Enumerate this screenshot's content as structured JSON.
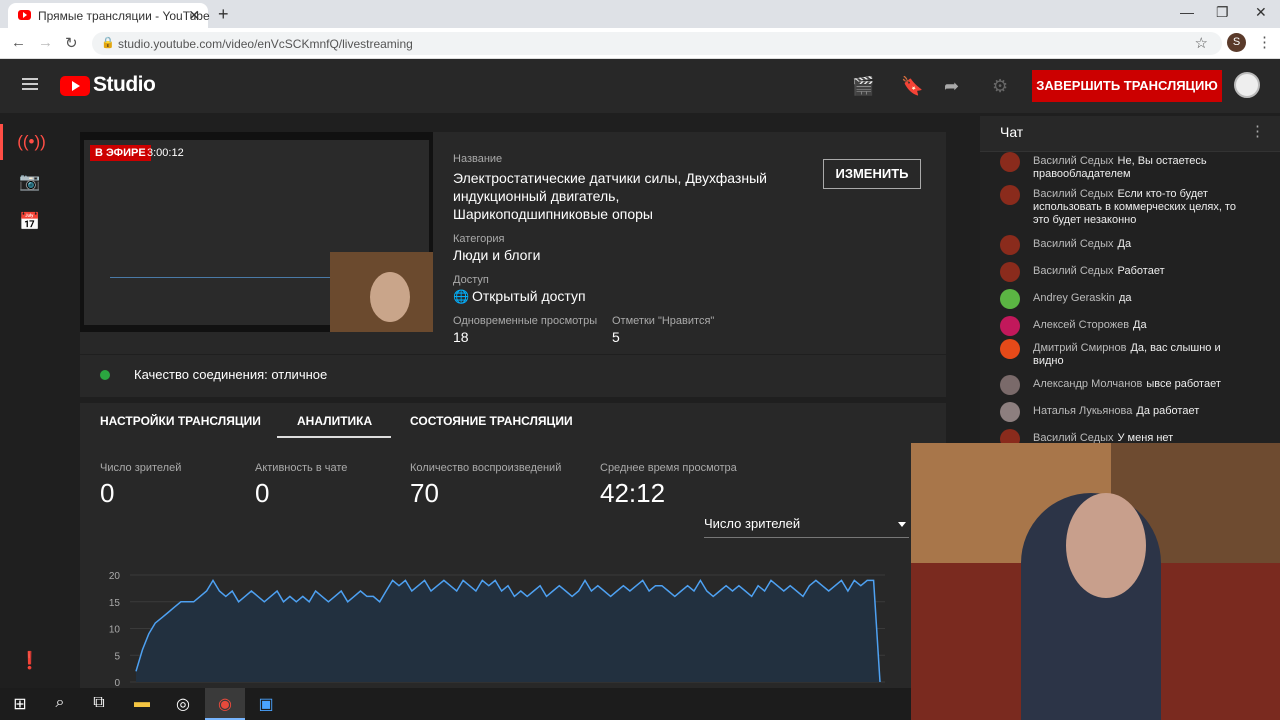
{
  "browser": {
    "tab_title": "Прямые трансляции - YouTube",
    "url": "studio.youtube.com/video/enVcSCKmnfQ/livestreaming",
    "profile_initial": "S"
  },
  "header": {
    "logo_text": "Studio",
    "end_stream_label": "ЗАВЕРШИТЬ ТРАНСЛЯЦИЮ"
  },
  "preview": {
    "live_badge": "В ЭФИРЕ",
    "live_time": "3:00:12"
  },
  "details": {
    "title_label": "Название",
    "title_value": "Электростатические датчики силы, Двухфазный индукционный двигатель, Шарикоподшипниковые опоры",
    "edit_label": "ИЗМЕНИТЬ",
    "category_label": "Категория",
    "category_value": "Люди и блоги",
    "access_label": "Доступ",
    "access_value": "Открытый доступ",
    "concurrent_label": "Одновременные просмотры",
    "concurrent_value": "18",
    "likes_label": "Отметки \"Нравится\"",
    "likes_value": "5"
  },
  "connection": {
    "text": "Качество соединения: отличное",
    "status_color": "#2ba640"
  },
  "tabs": [
    {
      "label": "НАСТРОЙКИ ТРАНСЛЯЦИИ"
    },
    {
      "label": "АНАЛИТИКА",
      "active": true
    },
    {
      "label": "СОСТОЯНИЕ ТРАНСЛЯЦИИ"
    }
  ],
  "metrics": [
    {
      "label": "Число зрителей",
      "value": "0"
    },
    {
      "label": "Активность в чате",
      "value": "0"
    },
    {
      "label": "Количество воспроизведений",
      "value": "70"
    },
    {
      "label": "Среднее время просмотра",
      "value": "42:12"
    }
  ],
  "dropdown": {
    "selected": "Число зрителей"
  },
  "chart_data": {
    "type": "area",
    "yticks": [
      "20",
      "15",
      "10",
      "5",
      "0"
    ],
    "ylim": [
      0,
      20
    ],
    "series": [
      {
        "values": [
          2,
          6,
          9,
          11,
          12,
          13,
          14,
          15,
          15,
          15,
          16,
          17,
          19,
          17,
          16,
          17,
          15,
          16,
          17,
          16,
          15,
          16,
          17,
          15,
          16,
          15,
          16,
          15,
          17,
          16,
          15,
          16,
          17,
          15,
          16,
          17,
          16,
          16,
          15,
          17,
          19,
          18,
          19,
          17,
          18,
          19,
          17,
          18,
          19,
          18,
          17,
          19,
          18,
          17,
          19,
          18,
          19,
          17,
          18,
          16,
          17,
          16,
          17,
          18,
          16,
          17,
          18,
          17,
          16,
          17,
          19,
          17,
          18,
          17,
          16,
          17,
          18,
          17,
          18,
          19,
          17,
          18,
          18,
          17,
          16,
          17,
          18,
          17,
          19,
          17,
          16,
          17,
          18,
          17,
          18,
          17,
          16,
          18,
          17,
          19,
          18,
          17,
          18,
          17,
          16,
          18,
          19,
          18,
          17,
          18,
          19,
          17,
          19,
          18,
          19,
          19,
          0
        ]
      }
    ]
  },
  "chat": {
    "title": "Чат",
    "messages": [
      {
        "author": "Василий Седых",
        "text": "Не, Вы остаетесь правообладателем",
        "color": "#8a2b1c"
      },
      {
        "author": "Василий Седых",
        "text": "Если кто-то будет использовать в коммерческих целях, то это будет незаконно",
        "color": "#8a2b1c"
      },
      {
        "author": "Василий Седых",
        "text": "Да",
        "color": "#8a2b1c"
      },
      {
        "author": "Василий Седых",
        "text": "Работает",
        "color": "#8a2b1c"
      },
      {
        "author": "Andrey Geraskin",
        "text": "да",
        "color": "#5bb543"
      },
      {
        "author": "Алексей Сторожев",
        "text": "Да",
        "color": "#c2185b"
      },
      {
        "author": "Дмитрий Смирнов",
        "text": "Да, вас слышно и видно",
        "color": "#e64a19"
      },
      {
        "author": "Александр Молчанов",
        "text": "ывсе работает",
        "color": "#7a6a6a"
      },
      {
        "author": "Наталья Лукьянова",
        "text": "Да работает",
        "color": "#8d7f7f"
      },
      {
        "author": "Василий Седых",
        "text": "У меня нет",
        "color": "#8a2b1c"
      }
    ]
  }
}
